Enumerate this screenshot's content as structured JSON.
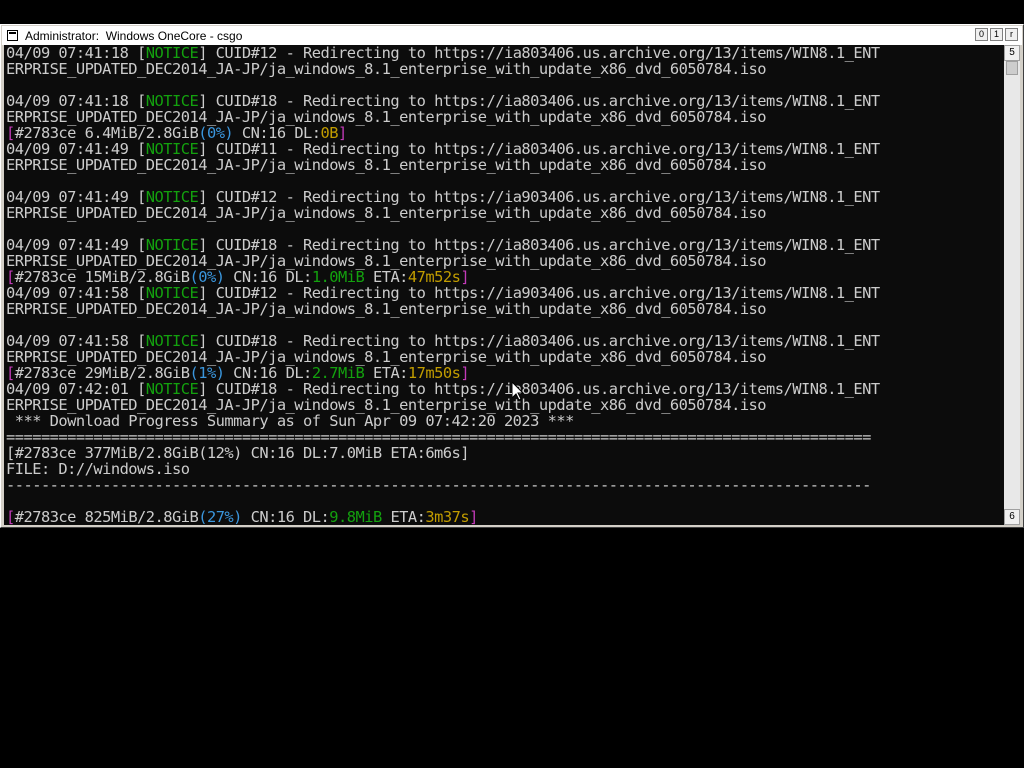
{
  "window": {
    "title": "Administrator:  Windows OneCore - csgo",
    "controls": {
      "minimize": "0",
      "maximize": "1",
      "close": "r"
    }
  },
  "scrollbar": {
    "up": "5",
    "down": "6"
  },
  "colors": {
    "background": "#0c0c0c",
    "text": "#cccccc",
    "notice": "#13a10e",
    "bracket": "#c23ab8",
    "percent": "#3a96dd",
    "speed_eta": "#c19c00"
  },
  "console": {
    "lines": [
      {
        "segments": [
          {
            "text": "04/09 07:41:18 [",
            "color": "default"
          },
          {
            "text": "NOTICE",
            "color": "g"
          },
          {
            "text": "] CUID#12 - Redirecting to https://ia803406.us.archive.org/13/items/WIN8.1_ENT",
            "color": "default"
          }
        ]
      },
      {
        "segments": [
          {
            "text": "ERPRISE_UPDATED_DEC2014_JA-JP/ja_windows_8.1_enterprise_with_update_x86_dvd_6050784.iso",
            "color": "default"
          }
        ]
      },
      {
        "segments": [
          {
            "text": "",
            "color": "default"
          }
        ]
      },
      {
        "segments": [
          {
            "text": "04/09 07:41:18 [",
            "color": "default"
          },
          {
            "text": "NOTICE",
            "color": "g"
          },
          {
            "text": "] CUID#18 - Redirecting to https://ia803406.us.archive.org/13/items/WIN8.1_ENT",
            "color": "default"
          }
        ]
      },
      {
        "segments": [
          {
            "text": "ERPRISE_UPDATED_DEC2014_JA-JP/ja_windows_8.1_enterprise_with_update_x86_dvd_6050784.iso",
            "color": "default"
          }
        ]
      },
      {
        "segments": [
          {
            "text": "[",
            "color": "m"
          },
          {
            "text": "#2783ce 6.4MiB/2.8GiB",
            "color": "default"
          },
          {
            "text": "(0%)",
            "color": "c"
          },
          {
            "text": " CN:16 DL:",
            "color": "default"
          },
          {
            "text": "0B",
            "color": "y"
          },
          {
            "text": "]",
            "color": "m"
          }
        ]
      },
      {
        "segments": [
          {
            "text": "04/09 07:41:49 [",
            "color": "default"
          },
          {
            "text": "NOTICE",
            "color": "g"
          },
          {
            "text": "] CUID#11 - Redirecting to https://ia803406.us.archive.org/13/items/WIN8.1_ENT",
            "color": "default"
          }
        ]
      },
      {
        "segments": [
          {
            "text": "ERPRISE_UPDATED_DEC2014_JA-JP/ja_windows_8.1_enterprise_with_update_x86_dvd_6050784.iso",
            "color": "default"
          }
        ]
      },
      {
        "segments": [
          {
            "text": "",
            "color": "default"
          }
        ]
      },
      {
        "segments": [
          {
            "text": "04/09 07:41:49 [",
            "color": "default"
          },
          {
            "text": "NOTICE",
            "color": "g"
          },
          {
            "text": "] CUID#12 - Redirecting to https://ia903406.us.archive.org/13/items/WIN8.1_ENT",
            "color": "default"
          }
        ]
      },
      {
        "segments": [
          {
            "text": "ERPRISE_UPDATED_DEC2014_JA-JP/ja_windows_8.1_enterprise_with_update_x86_dvd_6050784.iso",
            "color": "default"
          }
        ]
      },
      {
        "segments": [
          {
            "text": "",
            "color": "default"
          }
        ]
      },
      {
        "segments": [
          {
            "text": "04/09 07:41:49 [",
            "color": "default"
          },
          {
            "text": "NOTICE",
            "color": "g"
          },
          {
            "text": "] CUID#18 - Redirecting to https://ia803406.us.archive.org/13/items/WIN8.1_ENT",
            "color": "default"
          }
        ]
      },
      {
        "segments": [
          {
            "text": "ERPRISE_UPDATED_DEC2014_JA-JP/ja_windows_8.1_enterprise_with_update_x86_dvd_6050784.iso",
            "color": "default"
          }
        ]
      },
      {
        "segments": [
          {
            "text": "[",
            "color": "m"
          },
          {
            "text": "#2783ce 15MiB/2.8GiB",
            "color": "default"
          },
          {
            "text": "(0%)",
            "color": "c"
          },
          {
            "text": " CN:16 DL:",
            "color": "default"
          },
          {
            "text": "1.0MiB",
            "color": "g"
          },
          {
            "text": " ETA:",
            "color": "default"
          },
          {
            "text": "47m52s",
            "color": "y"
          },
          {
            "text": "]",
            "color": "m"
          }
        ]
      },
      {
        "segments": [
          {
            "text": "04/09 07:41:58 [",
            "color": "default"
          },
          {
            "text": "NOTICE",
            "color": "g"
          },
          {
            "text": "] CUID#12 - Redirecting to https://ia903406.us.archive.org/13/items/WIN8.1_ENT",
            "color": "default"
          }
        ]
      },
      {
        "segments": [
          {
            "text": "ERPRISE_UPDATED_DEC2014_JA-JP/ja_windows_8.1_enterprise_with_update_x86_dvd_6050784.iso",
            "color": "default"
          }
        ]
      },
      {
        "segments": [
          {
            "text": "",
            "color": "default"
          }
        ]
      },
      {
        "segments": [
          {
            "text": "04/09 07:41:58 [",
            "color": "default"
          },
          {
            "text": "NOTICE",
            "color": "g"
          },
          {
            "text": "] CUID#18 - Redirecting to https://ia803406.us.archive.org/13/items/WIN8.1_ENT",
            "color": "default"
          }
        ]
      },
      {
        "segments": [
          {
            "text": "ERPRISE_UPDATED_DEC2014_JA-JP/ja_windows_8.1_enterprise_with_update_x86_dvd_6050784.iso",
            "color": "default"
          }
        ]
      },
      {
        "segments": [
          {
            "text": "[",
            "color": "m"
          },
          {
            "text": "#2783ce 29MiB/2.8GiB",
            "color": "default"
          },
          {
            "text": "(1%)",
            "color": "c"
          },
          {
            "text": " CN:16 DL:",
            "color": "default"
          },
          {
            "text": "2.7MiB",
            "color": "g"
          },
          {
            "text": " ETA:",
            "color": "default"
          },
          {
            "text": "17m50s",
            "color": "y"
          },
          {
            "text": "]",
            "color": "m"
          }
        ]
      },
      {
        "segments": [
          {
            "text": "04/09 07:42:01 [",
            "color": "default"
          },
          {
            "text": "NOTICE",
            "color": "g"
          },
          {
            "text": "] CUID#18 - Redirecting to https://ia803406.us.archive.org/13/items/WIN8.1_ENT",
            "color": "default"
          }
        ]
      },
      {
        "segments": [
          {
            "text": "ERPRISE_UPDATED_DEC2014_JA-JP/ja_windows_8.1_enterprise_with_update_x86_dvd_6050784.iso",
            "color": "default"
          }
        ]
      },
      {
        "segments": [
          {
            "text": " *** Download Progress Summary as of Sun Apr 09 07:42:20 2023 ***",
            "color": "default"
          }
        ]
      },
      {
        "segments": [
          {
            "text": "===================================================================================================",
            "color": "default"
          }
        ]
      },
      {
        "segments": [
          {
            "text": "[#2783ce 377MiB/2.8GiB(12%) CN:16 DL:7.0MiB ETA:6m6s]",
            "color": "default"
          }
        ]
      },
      {
        "segments": [
          {
            "text": "FILE: D://windows.iso",
            "color": "default"
          }
        ]
      },
      {
        "segments": [
          {
            "text": "---------------------------------------------------------------------------------------------------",
            "color": "default"
          }
        ]
      },
      {
        "segments": [
          {
            "text": "",
            "color": "default"
          }
        ]
      },
      {
        "segments": [
          {
            "text": "[",
            "color": "m"
          },
          {
            "text": "#2783ce 825MiB/2.8GiB",
            "color": "default"
          },
          {
            "text": "(27%)",
            "color": "c"
          },
          {
            "text": " CN:16 DL:",
            "color": "default"
          },
          {
            "text": "9.8MiB",
            "color": "g"
          },
          {
            "text": " ETA:",
            "color": "default"
          },
          {
            "text": "3m37s",
            "color": "y"
          },
          {
            "text": "]",
            "color": "m"
          }
        ]
      }
    ]
  }
}
